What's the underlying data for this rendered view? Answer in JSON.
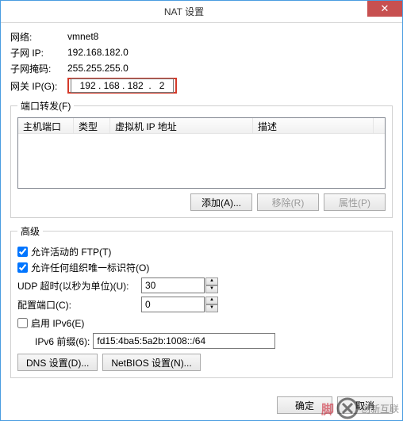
{
  "window": {
    "title": "NAT 设置",
    "close": "✕"
  },
  "info": {
    "network_label": "网络:",
    "network_value": "vmnet8",
    "subnetip_label": "子网 IP:",
    "subnetip_value": "192.168.182.0",
    "mask_label": "子网掩码:",
    "mask_value": "255.255.255.0",
    "gateway_label": "网关 IP(G):",
    "gateway_value": "192 . 168 . 182  .   2"
  },
  "portfwd": {
    "legend": "端口转发(F)",
    "cols": {
      "hostport": "主机端口",
      "type": "类型",
      "vmip": "虚拟机 IP 地址",
      "desc": "描述"
    },
    "add": "添加(A)...",
    "remove": "移除(R)",
    "props": "属性(P)"
  },
  "advanced": {
    "legend": "高级",
    "ftp": "允许活动的 FTP(T)",
    "uid": "允许任何组织唯一标识符(O)",
    "udp_label": "UDP 超时(以秒为单位)(U):",
    "udp_value": "30",
    "cfgport_label": "配置端口(C):",
    "cfgport_value": "0",
    "ipv6_enable": "启用 IPv6(E)",
    "ipv6_prefix_label": "IPv6 前缀(6):",
    "ipv6_prefix_value": "fd15:4ba5:5a2b:1008::/64",
    "dns_btn": "DNS 设置(D)...",
    "netbios_btn": "NetBIOS 设置(N)..."
  },
  "footer": {
    "ok": "确定",
    "cancel": "取消"
  },
  "watermark": {
    "text1": "脚",
    "text2": "创新互联"
  }
}
